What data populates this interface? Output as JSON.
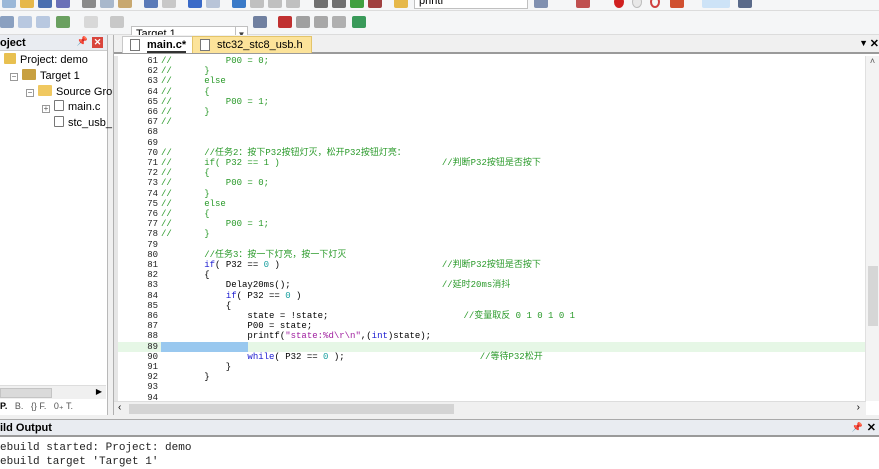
{
  "toolbar": {
    "target": "Target 1",
    "find_text": "printf"
  },
  "project_panel": {
    "title": "oject",
    "tree": [
      "Project: demo",
      "Target 1",
      "Source Grou",
      "main.c",
      "stc_usb_"
    ],
    "bottom_tabs": [
      "P.",
      "B.",
      "{} F.",
      "0₊ T."
    ]
  },
  "editor": {
    "tabs": [
      {
        "label": "main.c*",
        "active": true
      },
      {
        "label": "stc32_stc8_usb.h",
        "active": false
      }
    ],
    "current_line": 89,
    "lines": [
      {
        "n": "61",
        "s": [
          [
            "//          P00 = 0;",
            "c"
          ]
        ]
      },
      {
        "n": "62",
        "s": [
          [
            "//      }",
            "c"
          ]
        ]
      },
      {
        "n": "63",
        "s": [
          [
            "//      else",
            "c"
          ]
        ]
      },
      {
        "n": "64",
        "s": [
          [
            "//      {",
            "c"
          ]
        ]
      },
      {
        "n": "65",
        "s": [
          [
            "//          P00 = 1;",
            "c"
          ]
        ]
      },
      {
        "n": "66",
        "s": [
          [
            "//      }",
            "c"
          ]
        ]
      },
      {
        "n": "67",
        "s": [
          [
            "//",
            "c"
          ]
        ]
      },
      {
        "n": "68",
        "s": []
      },
      {
        "n": "69",
        "s": []
      },
      {
        "n": "70",
        "s": [
          [
            "//      //任务2：按下P32按钮灯灭，松开P32按钮灯亮：",
            "c"
          ]
        ]
      },
      {
        "n": "71",
        "s": [
          [
            "//      if( P32 == 1 )                              //判断P32按钮是否按下",
            "c"
          ]
        ]
      },
      {
        "n": "72",
        "s": [
          [
            "//      {",
            "c"
          ]
        ]
      },
      {
        "n": "73",
        "s": [
          [
            "//          P00 = 0;",
            "c"
          ]
        ]
      },
      {
        "n": "74",
        "s": [
          [
            "//      }",
            "c"
          ]
        ]
      },
      {
        "n": "75",
        "s": [
          [
            "//      else",
            "c"
          ]
        ]
      },
      {
        "n": "76",
        "s": [
          [
            "//      {",
            "c"
          ]
        ]
      },
      {
        "n": "77",
        "s": [
          [
            "//          P00 = 1;",
            "c"
          ]
        ]
      },
      {
        "n": "78",
        "s": [
          [
            "//      }",
            "c"
          ]
        ]
      },
      {
        "n": "79",
        "s": []
      },
      {
        "n": "80",
        "s": [
          [
            "        ",
            "p"
          ],
          [
            "//任务3：按一下灯亮，按一下灯灭",
            "c"
          ]
        ]
      },
      {
        "n": "81",
        "s": [
          [
            "        ",
            "p"
          ],
          [
            "if",
            "k"
          ],
          [
            "( P32 == ",
            "p"
          ],
          [
            "0",
            "n"
          ],
          [
            " )                              ",
            "p"
          ],
          [
            "//判断P32按钮是否按下",
            "c"
          ]
        ]
      },
      {
        "n": "82",
        "s": [
          [
            "        {",
            "p"
          ]
        ]
      },
      {
        "n": "83",
        "s": [
          [
            "            Delay20ms();                            ",
            "p"
          ],
          [
            "//延时20ms消抖",
            "c"
          ]
        ]
      },
      {
        "n": "84",
        "s": [
          [
            "            ",
            "p"
          ],
          [
            "if",
            "k"
          ],
          [
            "( P32 == ",
            "p"
          ],
          [
            "0",
            "n"
          ],
          [
            " )",
            "p"
          ]
        ]
      },
      {
        "n": "85",
        "s": [
          [
            "            {",
            "p"
          ]
        ]
      },
      {
        "n": "86",
        "s": [
          [
            "                state = !state;                         ",
            "p"
          ],
          [
            "//变量取反 0 1 0 1 0 1",
            "c"
          ]
        ]
      },
      {
        "n": "87",
        "s": [
          [
            "                P00 = state;",
            "p"
          ]
        ]
      },
      {
        "n": "88",
        "s": [
          [
            "                printf(",
            "p"
          ],
          [
            "\"state:%d\\r\\n\"",
            "s"
          ],
          [
            ",(",
            "p"
          ],
          [
            "int",
            "k"
          ],
          [
            ")state);",
            "p"
          ]
        ]
      },
      {
        "n": "89",
        "s": []
      },
      {
        "n": "90",
        "s": [
          [
            "                ",
            "p"
          ],
          [
            "while",
            "k"
          ],
          [
            "( P32 == ",
            "p"
          ],
          [
            "0",
            "n"
          ],
          [
            " );                         ",
            "p"
          ],
          [
            "//等待P32松开",
            "c"
          ]
        ]
      },
      {
        "n": "91",
        "s": [
          [
            "            }",
            "p"
          ]
        ]
      },
      {
        "n": "92",
        "s": [
          [
            "        }",
            "p"
          ]
        ]
      },
      {
        "n": "93",
        "s": []
      },
      {
        "n": "94",
        "s": []
      }
    ]
  },
  "build_output": {
    "title": "ild Output",
    "lines": [
      "ebuild started: Project: demo",
      "ebuild target 'Target 1'"
    ]
  }
}
